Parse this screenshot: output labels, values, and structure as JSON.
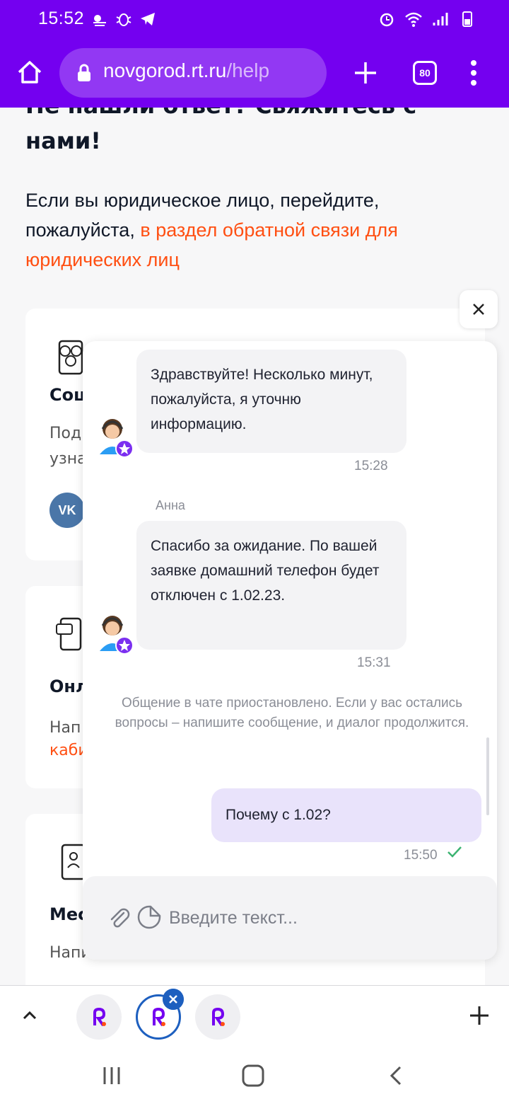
{
  "status_bar": {
    "time": "15:52",
    "left_icons": [
      "weather-icon",
      "bug-icon",
      "telegram-icon"
    ],
    "right_icons": [
      "alarm-icon",
      "wifi-icon",
      "signal-icon",
      "battery-icon"
    ]
  },
  "browser": {
    "url_host": "novgorod.rt.ru",
    "url_path": "/help",
    "tab_count": "80"
  },
  "page": {
    "heading": "Не нашли ответ? Свяжитесь с нами!",
    "intro_text": "Если вы юридическое лицо, перейдите, пожалуйста, ",
    "intro_link": "в раздел обратной связи для юридических лиц",
    "cards": [
      {
        "title": "Соц",
        "text_line1": "Под",
        "text_line2": "узна"
      },
      {
        "title": "Онл",
        "text_line1": "Нап",
        "text_line2": "каби"
      },
      {
        "title": "Мес",
        "text_line1": "Напи",
        "text_line2": ""
      }
    ]
  },
  "chat": {
    "messages": [
      {
        "author": "agent",
        "text": "Здравствуйте! Несколько минут, пожалуйста, я уточню информацию.",
        "time": "15:28"
      },
      {
        "author": "agent",
        "agent_name": "Анна",
        "text": "Спасибо за ожидание. По вашей заявке домашний телефон будет отключен с 1.02.23.",
        "time": "15:31"
      },
      {
        "author": "user",
        "text": "Почему с 1.02?",
        "time": "15:50"
      }
    ],
    "system_notice": "Общение в чате приостановлено. Если у вас остались вопросы – напишите сообщение, и диалог продолжится.",
    "input_placeholder": "Введите текст...",
    "colors": {
      "user_bubble": "#e9e3fb",
      "agent_bubble": "#f3f3f5",
      "brand": "#7400f0",
      "link": "#ff4f12"
    }
  }
}
